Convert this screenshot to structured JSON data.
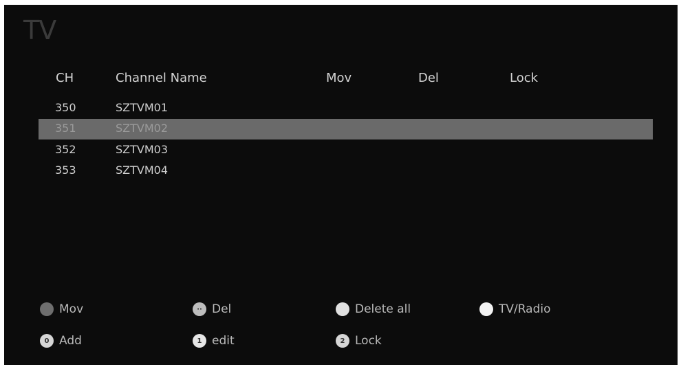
{
  "screen": {
    "title": "TV"
  },
  "table": {
    "headers": {
      "ch": "CH",
      "name": "Channel Name",
      "mov": "Mov",
      "del": "Del",
      "lock": "Lock"
    },
    "rows": [
      {
        "ch": "350",
        "name": "SZTVM01",
        "selected": false
      },
      {
        "ch": "351",
        "name": "SZTVM02",
        "selected": true
      },
      {
        "ch": "352",
        "name": "SZTVM03",
        "selected": false
      },
      {
        "ch": "353",
        "name": "SZTVM04",
        "selected": false
      }
    ]
  },
  "footer": {
    "mov": {
      "label": "Mov",
      "icon": "red-button-icon",
      "color": "#6e6e6e"
    },
    "del": {
      "label": "Del",
      "icon": "green-button-icon",
      "color": "#bdbdbd",
      "glyph": "··"
    },
    "delete_all": {
      "label": "Delete all",
      "icon": "yellow-button-icon",
      "color": "#e0e0e0"
    },
    "tv_radio": {
      "label": "TV/Radio",
      "icon": "blue-button-icon",
      "color": "#f2f2f2"
    },
    "add": {
      "label": "Add",
      "icon": "zero-button-icon",
      "color": "#d6d6d6",
      "glyph": "0"
    },
    "edit": {
      "label": "edit",
      "icon": "one-button-icon",
      "color": "#e6e6e6",
      "glyph": "1"
    },
    "lock": {
      "label": "Lock",
      "icon": "two-button-icon",
      "color": "#d6d6d6",
      "glyph": "2"
    }
  }
}
